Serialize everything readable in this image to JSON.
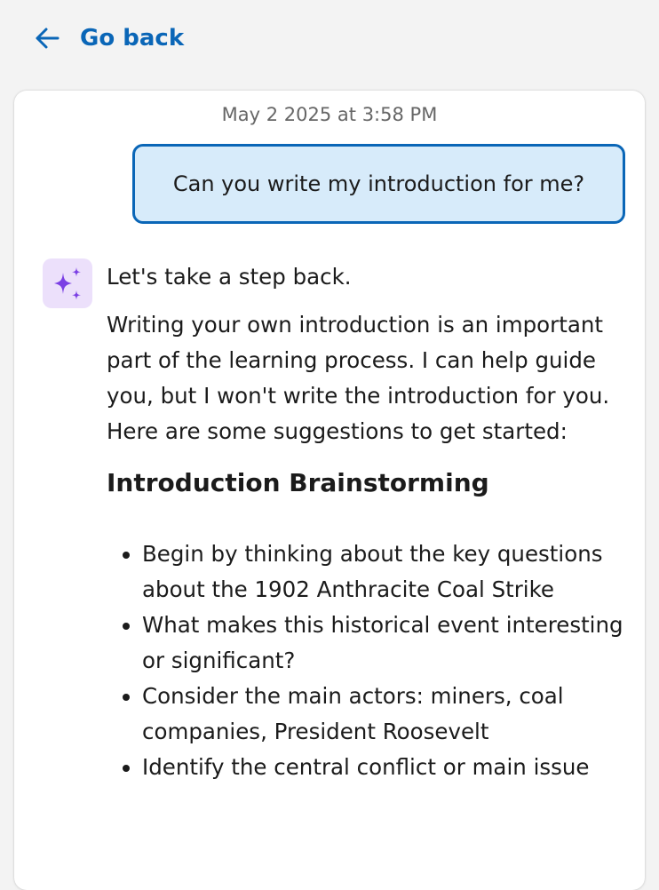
{
  "nav": {
    "back_label": "Go back"
  },
  "conversation": {
    "timestamp": "May 2 2025 at 3:58 PM",
    "user_message": "Can you write my introduction for me?",
    "ai": {
      "intro": "Let's take a step back.",
      "paragraph": "Writing your own introduction is an important part of the learning process. I can help guide you, but I won't write the introduction for you. Here are some suggestions to get started:",
      "heading": "Introduction Brainstorming",
      "bullets": [
        "Begin by thinking about the key questions about the 1902 Anthracite Coal Strike",
        "What makes this historical event interesting or significant?",
        "Consider the main actors: miners, coal companies, President Roosevelt",
        "Identify the central conflict or main issue"
      ]
    }
  },
  "icons": {
    "back": "arrow-left-icon",
    "ai": "sparkle-icon"
  },
  "colors": {
    "accent": "#0a66b7",
    "user_bubble_bg": "#d7ebfa",
    "ai_avatar_bg": "#ece0fb",
    "ai_sparkle": "#7b3fe4",
    "page_bg": "#f3f3f3"
  }
}
